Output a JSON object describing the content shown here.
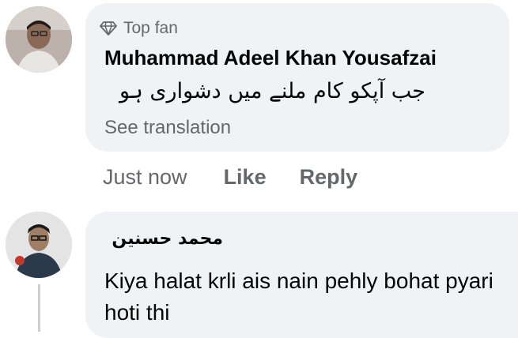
{
  "comments": [
    {
      "badge": "Top fan",
      "author": "Muhammad Adeel Khan Yousafzai",
      "text": "جب آپکو کام ملنے میں دشواری ہو",
      "see_translation": "See translation",
      "time": "Just now",
      "like_label": "Like",
      "reply_label": "Reply"
    },
    {
      "author": "محمد حسنین",
      "text": "Kiya halat krli ais nain pehly bohat pyari hoti thi"
    }
  ],
  "colors": {
    "bubble": "#f0f2f5",
    "secondary_text": "#65676b",
    "primary_text": "#050505"
  }
}
